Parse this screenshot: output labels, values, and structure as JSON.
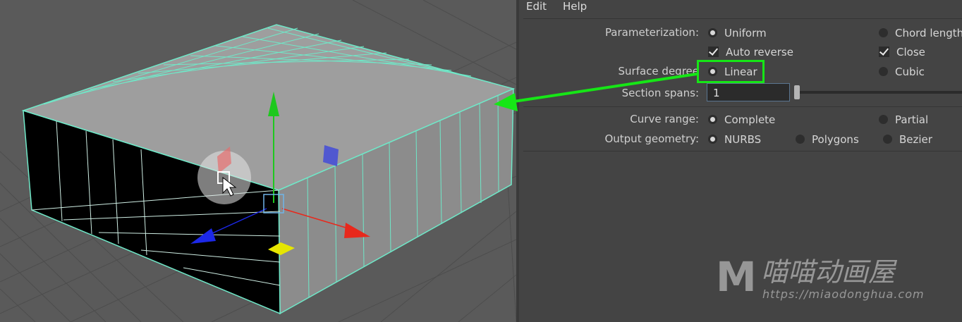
{
  "menu": {
    "edit": "Edit",
    "help": "Help"
  },
  "options": {
    "parameterization": {
      "label": "Parameterization:",
      "uniform": "Uniform",
      "chord_length": "Chord length",
      "selected": "Uniform"
    },
    "auto_reverse": {
      "label": "Auto reverse",
      "checked": true
    },
    "close": {
      "label": "Close",
      "checked": true
    },
    "surface_degree": {
      "label": "Surface degree",
      "linear": "Linear",
      "cubic": "Cubic",
      "selected": "Linear"
    },
    "section_spans": {
      "label": "Section spans:",
      "value": "1"
    },
    "curve_range": {
      "label": "Curve range:",
      "complete": "Complete",
      "partial": "Partial",
      "selected": "Complete"
    },
    "output_geometry": {
      "label": "Output geometry:",
      "nurbs": "NURBS",
      "polygons": "Polygons",
      "bezier": "Bezier",
      "selected": "NURBS"
    }
  },
  "annotation": {
    "color": "#16e616"
  },
  "watermark": {
    "logo": "M",
    "text": "喵喵动画屋",
    "url": "https://miaodonghua.com"
  },
  "colors": {
    "wire": "#6fe8c8",
    "surface": "#9a9a9a",
    "move_x": "#e8281c",
    "move_y": "#1ec81e",
    "move_z": "#1c28e8"
  }
}
